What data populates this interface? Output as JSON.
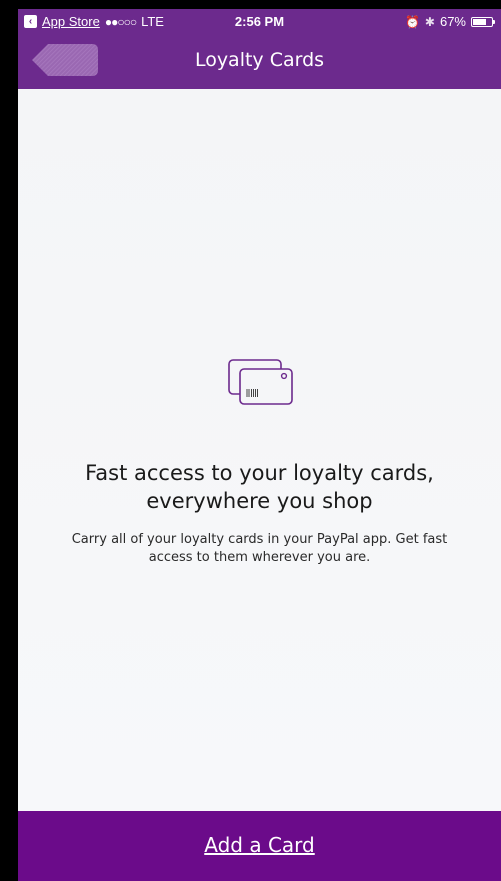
{
  "status_bar": {
    "back_app": "App Store",
    "signal": "●●○○○",
    "network": "LTE",
    "time": "2:56 PM",
    "battery": "67%"
  },
  "nav": {
    "title": "Loyalty Cards"
  },
  "empty_state": {
    "title": "Fast access to your loyalty cards, everywhere you shop",
    "description": "Carry all of your loyalty cards in your PayPal app. Get fast access to them wherever you are."
  },
  "bottom": {
    "add_card_label": "Add a Card"
  },
  "colors": {
    "header_purple": "#6c2a8d",
    "bottom_purple": "#6b0b8a",
    "background": "#f5f6f8",
    "icon_purple": "#6c2a8d"
  },
  "icons": {
    "back_app": "back-arrow-icon",
    "alarm": "alarm-icon",
    "bluetooth": "bluetooth-icon",
    "battery": "battery-icon",
    "nav_back": "back-tag-icon",
    "empty_state": "loyalty-cards-icon"
  }
}
